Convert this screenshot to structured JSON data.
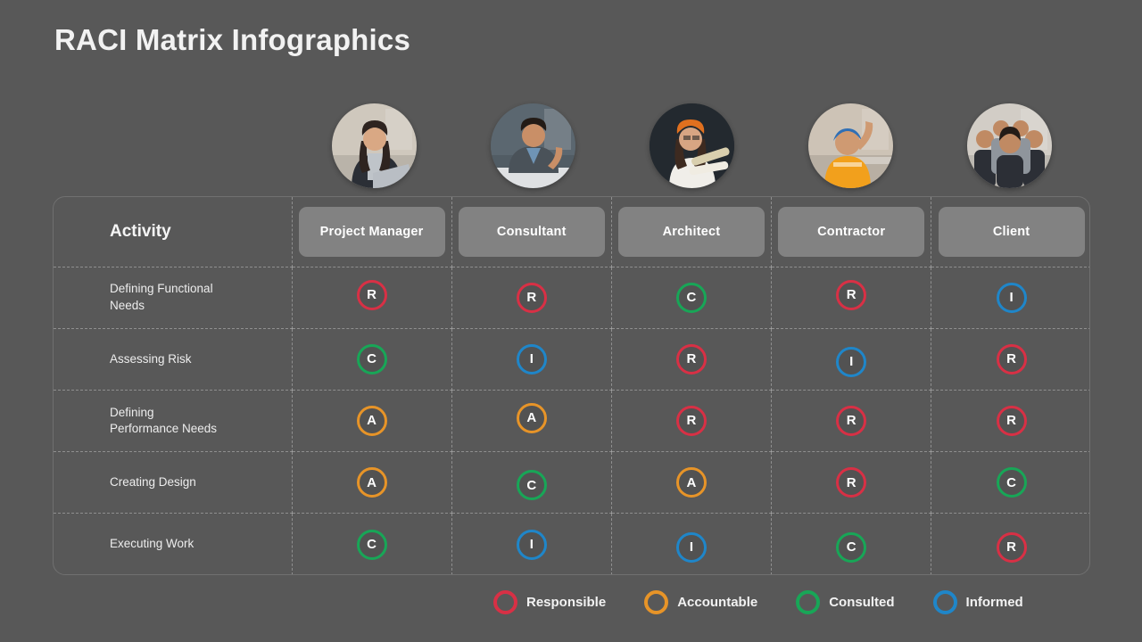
{
  "title": "RACI Matrix Infographics",
  "background_color": "#585858",
  "avatars": [
    {
      "name": "project-manager-avatar",
      "alt": "Businesswoman with laptop in office",
      "bg": "#cfc8bd",
      "skin": "#d9a884",
      "hair": "#2e2420",
      "clothes": "#2b2f36",
      "accent": "#bfc4c9"
    },
    {
      "name": "consultant-avatar",
      "alt": "Businessman in suit at desk",
      "bg": "#5b6770",
      "skin": "#c98f67",
      "hair": "#231b16",
      "clothes": "#4a5259",
      "accent": "#6f94b5"
    },
    {
      "name": "architect-avatar",
      "alt": "Architect woman with hard hat holding blueprints",
      "bg": "#23292f",
      "skin": "#d7a583",
      "hair": "#3d2a20",
      "clothes": "#f0eee9",
      "accent": "#e0701f"
    },
    {
      "name": "contractor-avatar",
      "alt": "Construction worker in hi-vis vest and hard hat",
      "bg": "#cdc3b6",
      "skin": "#cf9a72",
      "hair": "#2a211c",
      "clothes": "#f2a01c",
      "accent": "#2f6fb5"
    },
    {
      "name": "client-avatar",
      "alt": "Group of business people",
      "bg": "#d2cdc6",
      "skin": "#c08a63",
      "hair": "#241c17",
      "clothes": "#2c2f36",
      "accent": "#8f959c"
    }
  ],
  "table": {
    "activity_header": "Activity",
    "roles": [
      "Project Manager",
      "Consultant",
      "Architect",
      "Contractor",
      "Client"
    ],
    "rows": [
      {
        "activity": "Defining Functional\nNeeds",
        "activity_lines": [
          "Defining Functional",
          "Needs"
        ],
        "values": [
          "R",
          "R",
          "C",
          "R",
          "I"
        ],
        "offsets": [
          "up",
          "flat",
          "flat",
          "up",
          "flat"
        ]
      },
      {
        "activity": "Assessing Risk",
        "activity_lines": [
          "Assessing Risk"
        ],
        "values": [
          "C",
          "I",
          "R",
          "I",
          "R"
        ],
        "offsets": [
          "flat",
          "flat",
          "flat",
          "down",
          "flat"
        ]
      },
      {
        "activity": "Defining\nPerformance Needs",
        "activity_lines": [
          "Defining",
          "Performance Needs"
        ],
        "values": [
          "A",
          "A",
          "R",
          "R",
          "R"
        ],
        "offsets": [
          "flat",
          "up",
          "flat",
          "flat",
          "flat"
        ]
      },
      {
        "activity": "Creating Design",
        "activity_lines": [
          "Creating Design"
        ],
        "values": [
          "A",
          "C",
          "A",
          "R",
          "C"
        ],
        "offsets": [
          "flat",
          "down",
          "flat",
          "flat",
          "flat"
        ]
      },
      {
        "activity": "Executing Work",
        "activity_lines": [
          "Executing Work"
        ],
        "values": [
          "C",
          "I",
          "I",
          "C",
          "R"
        ],
        "offsets": [
          "flat",
          "flat",
          "down",
          "down",
          "down"
        ]
      }
    ]
  },
  "legend": [
    {
      "key": "R",
      "label": "Responsible",
      "color": "#d83045"
    },
    {
      "key": "A",
      "label": "Accountable",
      "color": "#e79428"
    },
    {
      "key": "C",
      "label": "Consulted",
      "color": "#18a657"
    },
    {
      "key": "I",
      "label": "Informed",
      "color": "#1f86c9"
    }
  ]
}
